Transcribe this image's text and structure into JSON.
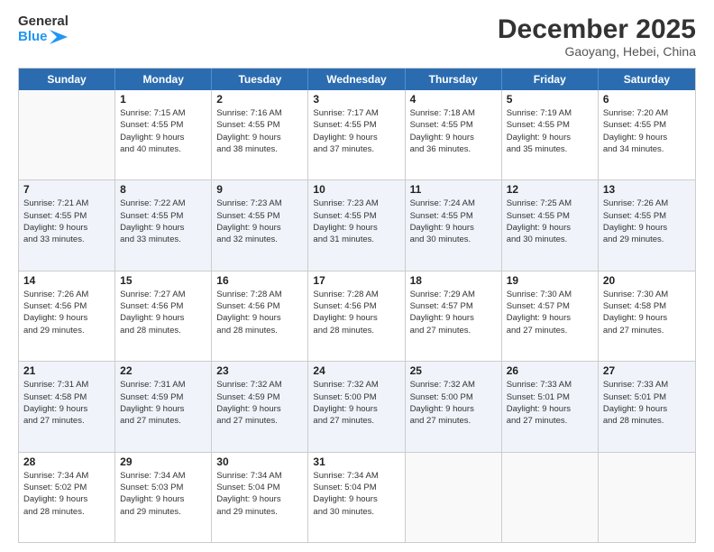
{
  "header": {
    "logo_line1": "General",
    "logo_line2": "Blue",
    "month_title": "December 2025",
    "location": "Gaoyang, Hebei, China"
  },
  "days_of_week": [
    "Sunday",
    "Monday",
    "Tuesday",
    "Wednesday",
    "Thursday",
    "Friday",
    "Saturday"
  ],
  "weeks": [
    [
      {
        "day": "",
        "info": ""
      },
      {
        "day": "1",
        "info": "Sunrise: 7:15 AM\nSunset: 4:55 PM\nDaylight: 9 hours\nand 40 minutes."
      },
      {
        "day": "2",
        "info": "Sunrise: 7:16 AM\nSunset: 4:55 PM\nDaylight: 9 hours\nand 38 minutes."
      },
      {
        "day": "3",
        "info": "Sunrise: 7:17 AM\nSunset: 4:55 PM\nDaylight: 9 hours\nand 37 minutes."
      },
      {
        "day": "4",
        "info": "Sunrise: 7:18 AM\nSunset: 4:55 PM\nDaylight: 9 hours\nand 36 minutes."
      },
      {
        "day": "5",
        "info": "Sunrise: 7:19 AM\nSunset: 4:55 PM\nDaylight: 9 hours\nand 35 minutes."
      },
      {
        "day": "6",
        "info": "Sunrise: 7:20 AM\nSunset: 4:55 PM\nDaylight: 9 hours\nand 34 minutes."
      }
    ],
    [
      {
        "day": "7",
        "info": "Sunrise: 7:21 AM\nSunset: 4:55 PM\nDaylight: 9 hours\nand 33 minutes."
      },
      {
        "day": "8",
        "info": "Sunrise: 7:22 AM\nSunset: 4:55 PM\nDaylight: 9 hours\nand 33 minutes."
      },
      {
        "day": "9",
        "info": "Sunrise: 7:23 AM\nSunset: 4:55 PM\nDaylight: 9 hours\nand 32 minutes."
      },
      {
        "day": "10",
        "info": "Sunrise: 7:23 AM\nSunset: 4:55 PM\nDaylight: 9 hours\nand 31 minutes."
      },
      {
        "day": "11",
        "info": "Sunrise: 7:24 AM\nSunset: 4:55 PM\nDaylight: 9 hours\nand 30 minutes."
      },
      {
        "day": "12",
        "info": "Sunrise: 7:25 AM\nSunset: 4:55 PM\nDaylight: 9 hours\nand 30 minutes."
      },
      {
        "day": "13",
        "info": "Sunrise: 7:26 AM\nSunset: 4:55 PM\nDaylight: 9 hours\nand 29 minutes."
      }
    ],
    [
      {
        "day": "14",
        "info": "Sunrise: 7:26 AM\nSunset: 4:56 PM\nDaylight: 9 hours\nand 29 minutes."
      },
      {
        "day": "15",
        "info": "Sunrise: 7:27 AM\nSunset: 4:56 PM\nDaylight: 9 hours\nand 28 minutes."
      },
      {
        "day": "16",
        "info": "Sunrise: 7:28 AM\nSunset: 4:56 PM\nDaylight: 9 hours\nand 28 minutes."
      },
      {
        "day": "17",
        "info": "Sunrise: 7:28 AM\nSunset: 4:56 PM\nDaylight: 9 hours\nand 28 minutes."
      },
      {
        "day": "18",
        "info": "Sunrise: 7:29 AM\nSunset: 4:57 PM\nDaylight: 9 hours\nand 27 minutes."
      },
      {
        "day": "19",
        "info": "Sunrise: 7:30 AM\nSunset: 4:57 PM\nDaylight: 9 hours\nand 27 minutes."
      },
      {
        "day": "20",
        "info": "Sunrise: 7:30 AM\nSunset: 4:58 PM\nDaylight: 9 hours\nand 27 minutes."
      }
    ],
    [
      {
        "day": "21",
        "info": "Sunrise: 7:31 AM\nSunset: 4:58 PM\nDaylight: 9 hours\nand 27 minutes."
      },
      {
        "day": "22",
        "info": "Sunrise: 7:31 AM\nSunset: 4:59 PM\nDaylight: 9 hours\nand 27 minutes."
      },
      {
        "day": "23",
        "info": "Sunrise: 7:32 AM\nSunset: 4:59 PM\nDaylight: 9 hours\nand 27 minutes."
      },
      {
        "day": "24",
        "info": "Sunrise: 7:32 AM\nSunset: 5:00 PM\nDaylight: 9 hours\nand 27 minutes."
      },
      {
        "day": "25",
        "info": "Sunrise: 7:32 AM\nSunset: 5:00 PM\nDaylight: 9 hours\nand 27 minutes."
      },
      {
        "day": "26",
        "info": "Sunrise: 7:33 AM\nSunset: 5:01 PM\nDaylight: 9 hours\nand 27 minutes."
      },
      {
        "day": "27",
        "info": "Sunrise: 7:33 AM\nSunset: 5:01 PM\nDaylight: 9 hours\nand 28 minutes."
      }
    ],
    [
      {
        "day": "28",
        "info": "Sunrise: 7:34 AM\nSunset: 5:02 PM\nDaylight: 9 hours\nand 28 minutes."
      },
      {
        "day": "29",
        "info": "Sunrise: 7:34 AM\nSunset: 5:03 PM\nDaylight: 9 hours\nand 29 minutes."
      },
      {
        "day": "30",
        "info": "Sunrise: 7:34 AM\nSunset: 5:04 PM\nDaylight: 9 hours\nand 29 minutes."
      },
      {
        "day": "31",
        "info": "Sunrise: 7:34 AM\nSunset: 5:04 PM\nDaylight: 9 hours\nand 30 minutes."
      },
      {
        "day": "",
        "info": ""
      },
      {
        "day": "",
        "info": ""
      },
      {
        "day": "",
        "info": ""
      }
    ]
  ]
}
